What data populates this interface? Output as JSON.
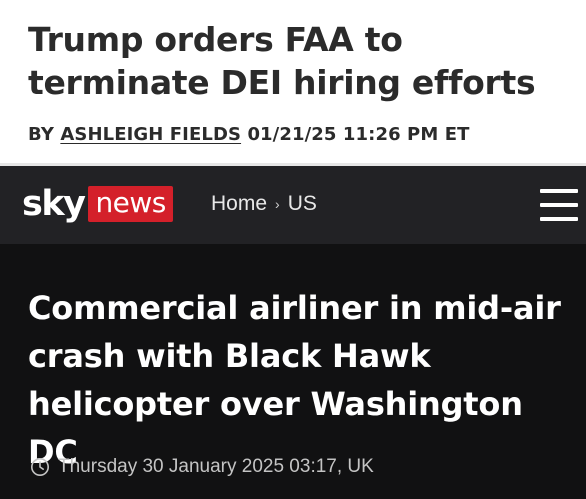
{
  "top_article": {
    "headline": "Trump orders FAA to terminate DEI hiring efforts",
    "byline_prefix": "BY",
    "author": "ASHLEIGH FIELDS",
    "timestamp": "01/21/25 11:26 PM ET"
  },
  "sky_header": {
    "logo_sky": "sky",
    "logo_news": "news",
    "breadcrumb": [
      "Home",
      "US"
    ],
    "breadcrumb_separator": "›",
    "menu_icon": "hamburger-menu-icon",
    "colors": {
      "header_bg": "#222225",
      "news_red": "#d4202a"
    }
  },
  "sky_article": {
    "headline": "Commercial airliner in mid-air crash with Black Hawk helicopter over Washington DC",
    "timestamp": "Thursday 30 January 2025 03:17, UK",
    "clock_icon": "clock-icon",
    "colors": {
      "bg": "#111112",
      "text": "#ffffff"
    }
  }
}
